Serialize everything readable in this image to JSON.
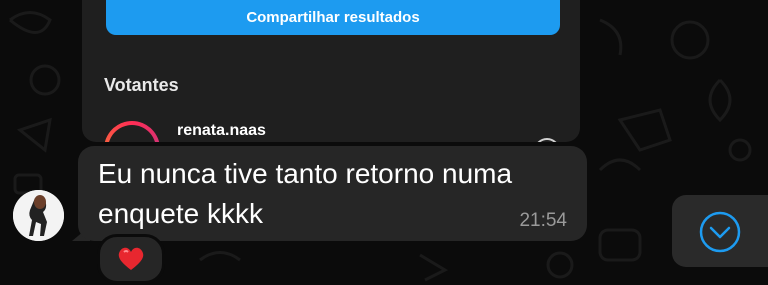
{
  "poll_card": {
    "share_button_label": "Compartilhar resultados",
    "voters_title": "Votantes",
    "voters": [
      {
        "name": "renata.naas"
      }
    ]
  },
  "message": {
    "text": "Eu nunca tive tanto retorno numa\nenquete kkkk",
    "time": "21:54",
    "reaction": "heart-emoji"
  },
  "colors": {
    "background": "#0b0b0b",
    "bubble": "#262626",
    "accent_button": "#1d9bf0",
    "scroll_icon": "#1d9bf0"
  },
  "icons": {
    "scroll_button": "chevron-down-circle-icon",
    "reaction": "heart-icon"
  }
}
